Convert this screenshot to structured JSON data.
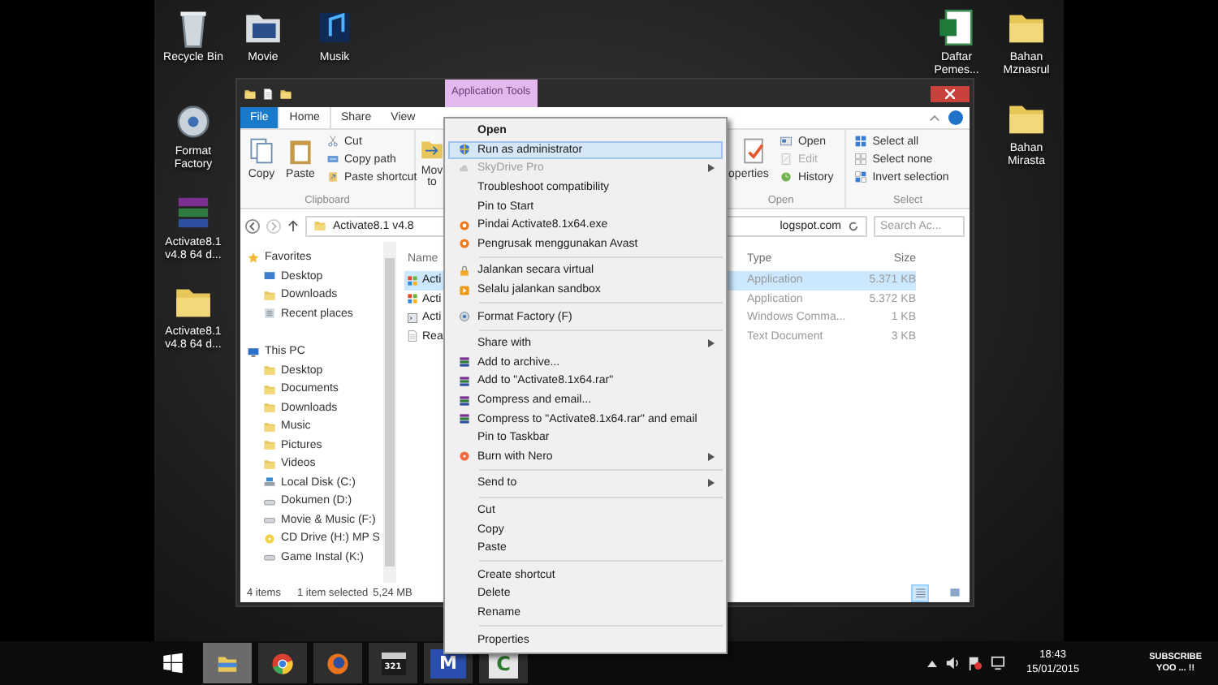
{
  "desktop": {
    "icons": [
      {
        "label": "Recycle Bin",
        "kind": "bin"
      },
      {
        "label": "Movie",
        "kind": "video"
      },
      {
        "label": "Musik",
        "kind": "music"
      },
      {
        "label": "Format Factory",
        "kind": "factory"
      },
      {
        "label": "Activate8.1 v4.8 64 d...",
        "kind": "books"
      },
      {
        "label": "Activate8.1 v4.8 64 d...",
        "kind": "folder"
      },
      {
        "label": "Daftar Pemes...",
        "kind": "sheet"
      },
      {
        "label": "Bahan Mznasrul",
        "kind": "folder"
      },
      {
        "label": "Bahan Mirasta",
        "kind": "folder"
      }
    ]
  },
  "explorer": {
    "contextual_tab": "Application Tools",
    "tabs": [
      {
        "label": "File",
        "selected": false,
        "kind": "file"
      },
      {
        "label": "Home",
        "selected": true,
        "kind": "tab"
      },
      {
        "label": "Share",
        "selected": false,
        "kind": "tab"
      },
      {
        "label": "View",
        "selected": false,
        "kind": "tab"
      }
    ],
    "clipboard": {
      "label": "Clipboard",
      "copy": "Copy",
      "paste": "Paste",
      "cut": "Cut",
      "copy_path": "Copy path",
      "paste_shortcut": "Paste shortcut"
    },
    "move_to": "Mov to",
    "properties": "operties",
    "open_group": {
      "label": "Open",
      "items": [
        {
          "label": "Open",
          "disabled": false,
          "kind": "dropdown"
        },
        {
          "label": "Edit",
          "disabled": true,
          "kind": "edit"
        },
        {
          "label": "History",
          "disabled": false,
          "kind": "history"
        }
      ]
    },
    "select_group": {
      "label": "Select",
      "items": [
        {
          "label": "Select all",
          "kind": "all"
        },
        {
          "label": "Select none",
          "kind": "none"
        },
        {
          "label": "Invert selection",
          "kind": "invert"
        }
      ]
    },
    "address": {
      "path": "Activate8.1 v4.8",
      "path_tail": "logspot.com",
      "search_placeholder": "Search Ac..."
    },
    "nav": [
      {
        "label": "Favorites",
        "kind": "star",
        "children": [
          {
            "label": "Desktop",
            "kind": "desktop"
          },
          {
            "label": "Downloads",
            "kind": "folder"
          },
          {
            "label": "Recent places",
            "kind": "recent"
          }
        ]
      },
      {
        "label": "This PC",
        "kind": "pc",
        "children": [
          {
            "label": "Desktop",
            "kind": "folder"
          },
          {
            "label": "Documents",
            "kind": "folder"
          },
          {
            "label": "Downloads",
            "kind": "folder"
          },
          {
            "label": "Music",
            "kind": "folder"
          },
          {
            "label": "Pictures",
            "kind": "folder"
          },
          {
            "label": "Videos",
            "kind": "folder"
          },
          {
            "label": "Local Disk (C:)",
            "kind": "system"
          },
          {
            "label": "Dokumen (D:)",
            "kind": "drive"
          },
          {
            "label": "Movie & Music (F:)",
            "kind": "drive"
          },
          {
            "label": "CD Drive (H:) MP S",
            "kind": "disc"
          },
          {
            "label": "Game Instal (K:)",
            "kind": "drive"
          }
        ]
      }
    ],
    "columns": [
      {
        "label": "Name"
      },
      {
        "label": "Type"
      },
      {
        "label": "Size"
      }
    ],
    "rows": [
      {
        "name": "Acti",
        "type": "Application",
        "size": "5.371 KB",
        "selected": true,
        "kind": "app"
      },
      {
        "name": "Acti",
        "type": "Application",
        "size": "5.372 KB",
        "selected": false,
        "kind": "app"
      },
      {
        "name": "Acti",
        "type": "Windows Comma...",
        "size": "1 KB",
        "selected": false,
        "kind": "cmd"
      },
      {
        "name": "Rea",
        "type": "Text Document",
        "size": "3 KB",
        "selected": false,
        "kind": "text"
      }
    ],
    "status": {
      "count": "4 items",
      "selection": "1 item selected",
      "size": "5,24 MB"
    },
    "views": [
      {
        "kind": "details",
        "selected": true
      },
      {
        "kind": "tiles",
        "selected": false
      }
    ]
  },
  "context_menu": [
    {
      "label": "Open",
      "kind": "bold",
      "selected": false,
      "disabled": false,
      "submenu": false
    },
    {
      "label": "Run as administrator",
      "kind": "shield",
      "selected": true,
      "disabled": false,
      "submenu": false
    },
    {
      "label": "SkyDrive Pro",
      "kind": "cloud",
      "selected": false,
      "disabled": true,
      "submenu": true
    },
    {
      "label": "Troubleshoot compatibility",
      "kind": "plain",
      "selected": false,
      "disabled": false,
      "submenu": false
    },
    {
      "label": "Pin to Start",
      "kind": "plain",
      "selected": false,
      "disabled": false,
      "submenu": false
    },
    {
      "label": "Pindai Activate8.1x64.exe",
      "kind": "avast",
      "selected": false,
      "disabled": false,
      "submenu": false
    },
    {
      "label": "Pengrusak menggunakan Avast",
      "kind": "avast",
      "selected": false,
      "disabled": false,
      "submenu": false
    },
    {
      "kind": "separator"
    },
    {
      "label": "Jalankan secara virtual",
      "kind": "lock",
      "selected": false,
      "disabled": false,
      "submenu": false
    },
    {
      "label": "Selalu jalankan sandbox",
      "kind": "sandbox",
      "selected": false,
      "disabled": false,
      "submenu": false
    },
    {
      "kind": "separator"
    },
    {
      "label": "Format Factory (F)",
      "kind": "factory",
      "selected": false,
      "disabled": false,
      "submenu": false
    },
    {
      "kind": "separator"
    },
    {
      "label": "Share with",
      "kind": "plain",
      "selected": false,
      "disabled": false,
      "submenu": true
    },
    {
      "label": "Add to archive...",
      "kind": "books",
      "selected": false,
      "disabled": false,
      "submenu": false
    },
    {
      "label": "Add to \"Activate8.1x64.rar\"",
      "kind": "books",
      "selected": false,
      "disabled": false,
      "submenu": false
    },
    {
      "label": "Compress and email...",
      "kind": "books",
      "selected": false,
      "disabled": false,
      "submenu": false
    },
    {
      "label": "Compress to \"Activate8.1x64.rar\" and email",
      "kind": "books",
      "selected": false,
      "disabled": false,
      "submenu": false
    },
    {
      "label": "Pin to Taskbar",
      "kind": "plain",
      "selected": false,
      "disabled": false,
      "submenu": false
    },
    {
      "label": "Burn with Nero",
      "kind": "nero",
      "selected": false,
      "disabled": false,
      "submenu": true
    },
    {
      "kind": "separator"
    },
    {
      "label": "Send to",
      "kind": "plain",
      "selected": false,
      "disabled": false,
      "submenu": true
    },
    {
      "kind": "separator"
    },
    {
      "label": "Cut",
      "kind": "plain",
      "selected": false,
      "disabled": false,
      "submenu": false
    },
    {
      "label": "Copy",
      "kind": "plain",
      "selected": false,
      "disabled": false,
      "submenu": false
    },
    {
      "label": "Paste",
      "kind": "plain",
      "selected": false,
      "disabled": false,
      "submenu": false
    },
    {
      "kind": "separator"
    },
    {
      "label": "Create shortcut",
      "kind": "plain",
      "selected": false,
      "disabled": false,
      "submenu": false
    },
    {
      "label": "Delete",
      "kind": "plain",
      "selected": false,
      "disabled": false,
      "submenu": false
    },
    {
      "label": "Rename",
      "kind": "plain",
      "selected": false,
      "disabled": false,
      "submenu": false
    },
    {
      "kind": "separator"
    },
    {
      "label": "Properties",
      "kind": "plain",
      "selected": false,
      "disabled": false,
      "submenu": false
    }
  ],
  "taskbar": {
    "apps": [
      {
        "kind": "explorer",
        "selected": true
      },
      {
        "kind": "chrome",
        "selected": false
      },
      {
        "kind": "firefox",
        "selected": false
      },
      {
        "kind": "media",
        "label": "321",
        "selected": false
      },
      {
        "kind": "letter",
        "label": "M",
        "selected": false
      },
      {
        "kind": "camtasia",
        "label": "C",
        "selected": false
      }
    ],
    "time": "18:43",
    "date": "15/01/2015"
  },
  "overlay": {
    "line1": "SUBSCRIBE",
    "line2": "YOO ... !!"
  }
}
